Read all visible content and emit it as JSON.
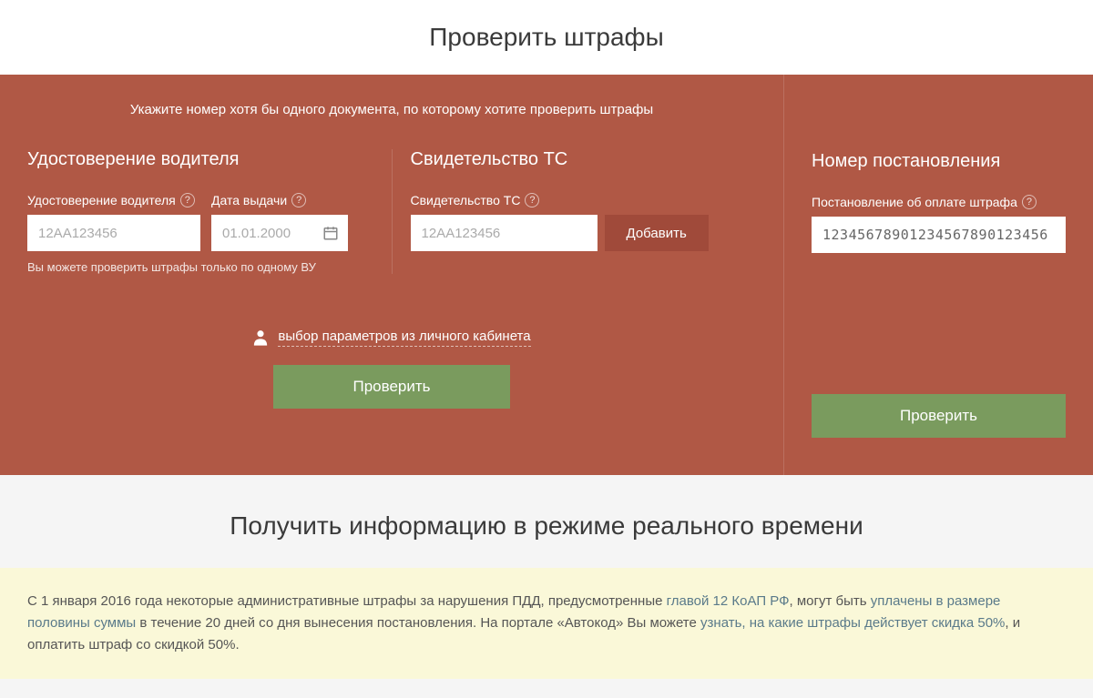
{
  "pageTitle": "Проверить штрафы",
  "instruction": "Укажите номер хотя бы одного документа, по которому хотите проверить штрафы",
  "driverLicense": {
    "title": "Удостоверение водителя",
    "licenseLabel": "Удостоверение водителя",
    "licensePlaceholder": "12АА123456",
    "dateLabel": "Дата выдачи",
    "datePlaceholder": "01.01.2000",
    "hint": "Вы можете проверить штрафы только по одному ВУ"
  },
  "certificate": {
    "title": "Свидетельство ТС",
    "label": "Свидетельство ТС",
    "placeholder": "12АА123456",
    "addButton": "Добавить"
  },
  "resolution": {
    "title": "Номер постановления",
    "label": "Постановление об оплате штрафа",
    "value": "12345678901234567890123456"
  },
  "profileLink": "выбор параметров из личного кабинета",
  "checkButton": "Проверить",
  "infoTitle": "Получить информацию в режиме реального времени",
  "infoBox": {
    "text1": "С 1 января 2016 года некоторые административные штрафы за нарушения ПДД, предусмотренные ",
    "link1": "главой 12 КоАП РФ",
    "text2": ", могут быть ",
    "link2": "уплачены в размере половины суммы",
    "text3": " в течение 20 дней со дня вынесения постановления. На портале «Автокод» Вы можете ",
    "link3": "узнать, на какие штрафы действует скидка 50%",
    "text4": ", и оплатить штраф со скидкой 50%."
  }
}
